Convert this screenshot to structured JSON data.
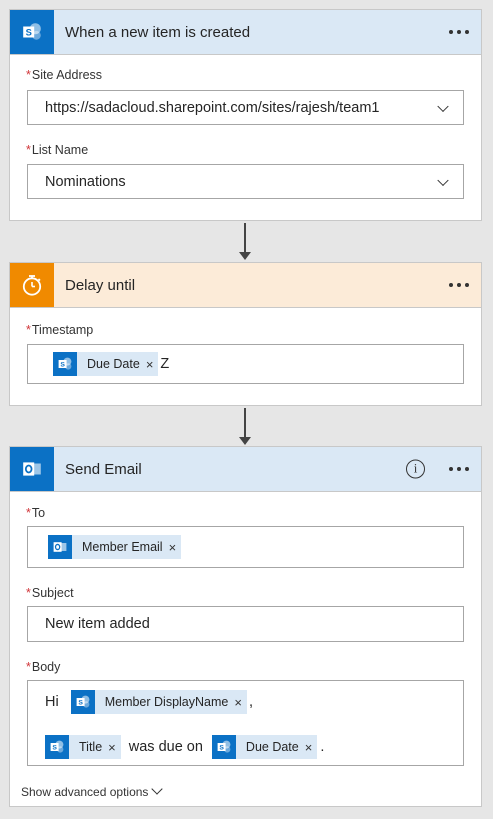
{
  "trigger": {
    "title": "When a new item is created",
    "icon": "sharepoint-icon",
    "site_address": {
      "label": "Site Address",
      "value": "https://sadacloud.sharepoint.com/sites/rajesh/team1"
    },
    "list_name": {
      "label": "List Name",
      "value": "Nominations"
    }
  },
  "delay": {
    "title": "Delay until",
    "icon": "timer-icon",
    "timestamp": {
      "label": "Timestamp",
      "token": "Due Date",
      "suffix": "Z"
    }
  },
  "email": {
    "title": "Send Email",
    "icon": "outlook-icon",
    "to": {
      "label": "To",
      "token": "Member Email"
    },
    "subject": {
      "label": "Subject",
      "value": "New item added"
    },
    "body": {
      "label": "Body",
      "prefix": "Hi",
      "token1": "Member DisplayName",
      "comma": ",",
      "token2": "Title",
      "middle": "was due on",
      "token3": "Due Date",
      "end": "."
    },
    "advanced": "Show advanced options"
  },
  "required_marker": "*",
  "remove_glyph": "×",
  "colors": {
    "sharepoint": "#0b71c5",
    "delay": "#f08a00",
    "header_blue": "#dae8f5",
    "header_orange": "#fcebd8",
    "required": "#d13438"
  }
}
